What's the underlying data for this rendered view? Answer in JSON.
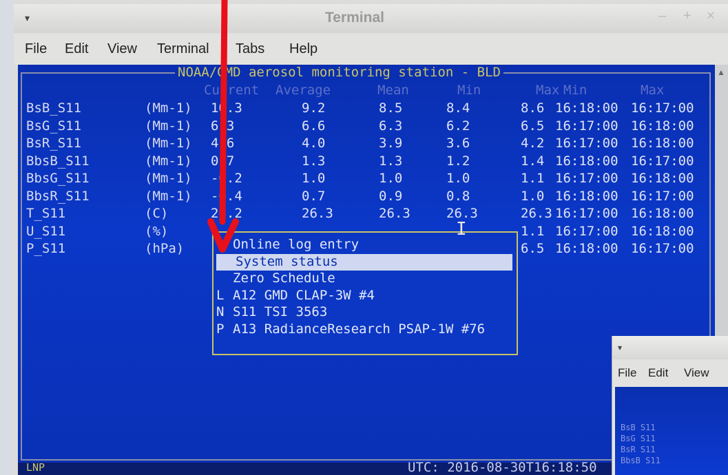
{
  "window": {
    "title": "Terminal",
    "menu_arrow": "▾",
    "btn_minimize": "–",
    "btn_maximize": "+",
    "btn_close": "×"
  },
  "menu": {
    "file": "File",
    "edit": "Edit",
    "view": "View",
    "terminal": "Terminal",
    "tabs": "Tabs",
    "help": "Help"
  },
  "screen": {
    "frame_title": "NOAA/GMD aerosol monitoring station - BLD",
    "headers": {
      "current": "Current",
      "average": "Average",
      "mean": "Mean",
      "min": "Min",
      "max": "Max",
      "min_time": "Min",
      "max_time": "Max"
    },
    "rows": [
      {
        "name": "BsB_S11",
        "unit": "(Mm-1)",
        "current": "10.3",
        "average": "9.2",
        "mean": "8.5",
        "min": "8.4",
        "max": "8.6",
        "t1": "16:18:00",
        "t2": "16:17:00"
      },
      {
        "name": "BsG_S11",
        "unit": "(Mm-1)",
        "current": "6.3",
        "average": "6.6",
        "mean": "6.3",
        "min": "6.2",
        "max": "6.5",
        "t1": "16:17:00",
        "t2": "16:18:00"
      },
      {
        "name": "BsR_S11",
        "unit": "(Mm-1)",
        "current": "4.6",
        "average": "4.0",
        "mean": "3.9",
        "min": "3.6",
        "max": "4.2",
        "t1": "16:17:00",
        "t2": "16:18:00"
      },
      {
        "name": "BbsB_S11",
        "unit": "(Mm-1)",
        "current": "0.7",
        "average": "1.3",
        "mean": "1.3",
        "min": "1.2",
        "max": "1.4",
        "t1": "16:18:00",
        "t2": "16:17:00"
      },
      {
        "name": "BbsG_S11",
        "unit": "(Mm-1)",
        "current": "-0.2",
        "average": "1.0",
        "mean": "1.0",
        "min": "1.0",
        "max": "1.1",
        "t1": "16:17:00",
        "t2": "16:18:00"
      },
      {
        "name": "BbsR_S11",
        "unit": "(Mm-1)",
        "current": "-0.4",
        "average": "0.7",
        "mean": "0.9",
        "min": "0.8",
        "max": "1.0",
        "t1": "16:18:00",
        "t2": "16:17:00"
      },
      {
        "name": "T_S11",
        "unit": "(C)",
        "current": "26.2",
        "average": "26.3",
        "mean": "26.3",
        "min": "26.3",
        "max": "26.3",
        "t1": "16:17:00",
        "t2": "16:18:00"
      },
      {
        "name": "U_S11",
        "unit": "(%)",
        "current": "",
        "average": "",
        "mean": "",
        "min": "",
        "max": "1.1",
        "t1": "16:17:00",
        "t2": "16:18:00"
      },
      {
        "name": "P_S11",
        "unit": "(hPa)",
        "current": "",
        "average": "",
        "mean": "",
        "min": "",
        "max": "6.5",
        "t1": "16:18:00",
        "t2": "16:17:00"
      }
    ],
    "popup": [
      {
        "key": "",
        "label": "Online log entry"
      },
      {
        "key": "",
        "label": "System status"
      },
      {
        "key": "",
        "label": "Zero Schedule"
      },
      {
        "key": "L",
        "label": "A12 GMD CLAP-3W #4"
      },
      {
        "key": "N",
        "label": "S11 TSI 3563"
      },
      {
        "key": "P",
        "label": "A13 RadianceResearch PSAP-1W #76"
      }
    ],
    "status_left": "LNP",
    "status_utc": "UTC: 2016-08-30T16:18:50"
  },
  "window2": {
    "menu_arrow": "▾",
    "file": "File",
    "edit": "Edit",
    "view": "View",
    "rows": [
      "BsB S11",
      "BsG S11",
      "BsR S11",
      "BbsB S11"
    ]
  },
  "colors": {
    "terminal_bg": "#0a33be",
    "frame_title": "#c9c466",
    "popup_border": "#c9c466",
    "annotation_arrow": "#e8101a"
  }
}
